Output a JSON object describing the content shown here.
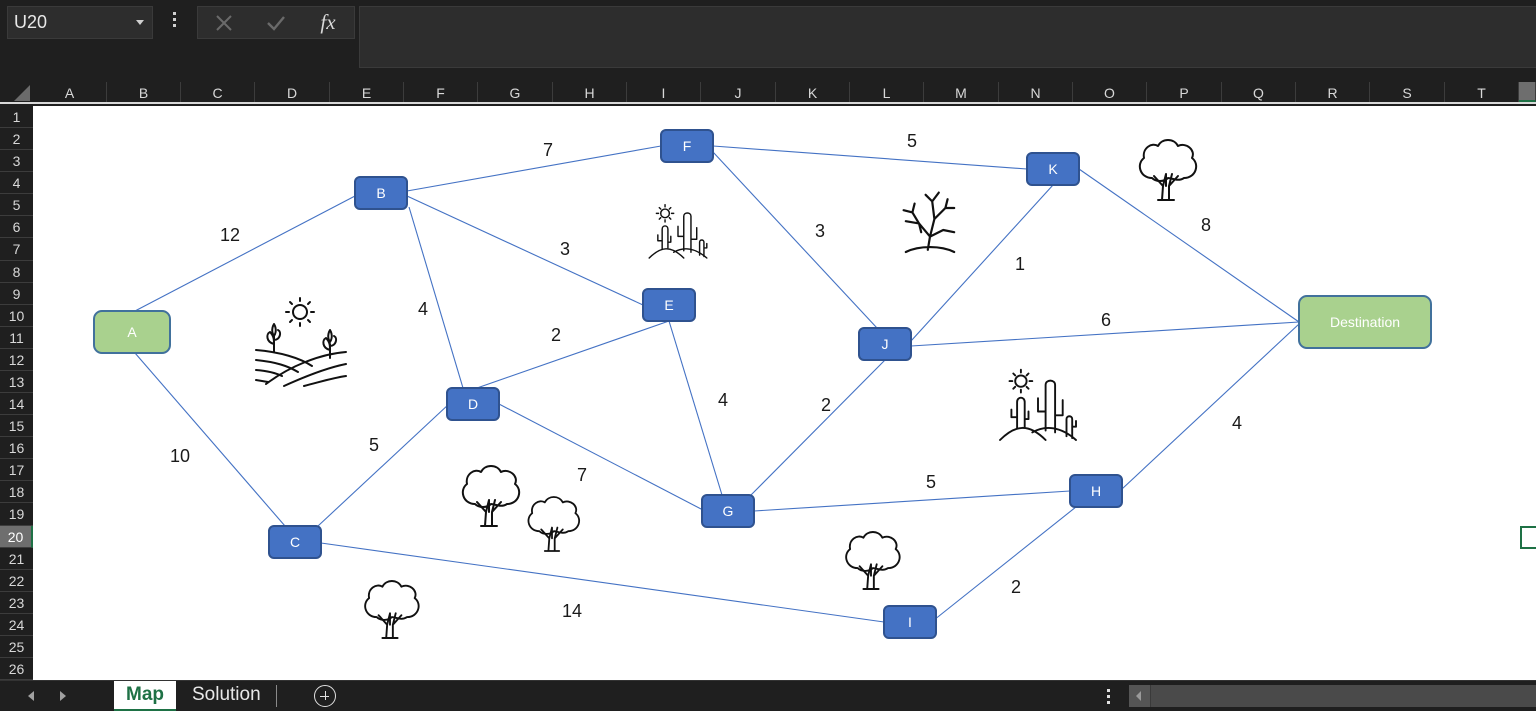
{
  "formula_bar": {
    "name_box": "U20",
    "cancel_icon": "close-icon",
    "enter_icon": "check-icon",
    "function_label": "fx",
    "formula_value": ""
  },
  "columns": [
    "A",
    "B",
    "C",
    "D",
    "E",
    "F",
    "G",
    "H",
    "I",
    "J",
    "K",
    "L",
    "M",
    "N",
    "O",
    "P",
    "Q",
    "R",
    "S",
    "T"
  ],
  "rows": [
    "1",
    "2",
    "3",
    "4",
    "5",
    "6",
    "7",
    "8",
    "9",
    "10",
    "11",
    "12",
    "13",
    "14",
    "15",
    "16",
    "17",
    "18",
    "19",
    "20",
    "21",
    "22",
    "23",
    "24",
    "25",
    "26"
  ],
  "selected_row": "20",
  "sheet_tabs": [
    {
      "label": "Map",
      "active": true
    },
    {
      "label": "Solution",
      "active": false
    }
  ],
  "diagram": {
    "colors": {
      "node_fill": "#4472c4",
      "node_stroke": "#2f528f",
      "terminal_fill": "#a9d18e",
      "terminal_stroke": "#41719c",
      "edge": "#4472c4"
    },
    "nodes": [
      {
        "id": "A",
        "label": "A",
        "type": "terminal"
      },
      {
        "id": "B",
        "label": "B",
        "type": "node"
      },
      {
        "id": "C",
        "label": "C",
        "type": "node"
      },
      {
        "id": "D",
        "label": "D",
        "type": "node"
      },
      {
        "id": "E",
        "label": "E",
        "type": "node"
      },
      {
        "id": "F",
        "label": "F",
        "type": "node"
      },
      {
        "id": "G",
        "label": "G",
        "type": "node"
      },
      {
        "id": "H",
        "label": "H",
        "type": "node"
      },
      {
        "id": "I",
        "label": "I",
        "type": "node"
      },
      {
        "id": "J",
        "label": "J",
        "type": "node"
      },
      {
        "id": "K",
        "label": "K",
        "type": "node"
      },
      {
        "id": "Dest",
        "label": "Destination",
        "type": "terminal"
      }
    ],
    "edges": [
      {
        "from": "A",
        "to": "B",
        "weight": "12"
      },
      {
        "from": "A",
        "to": "C",
        "weight": "10"
      },
      {
        "from": "B",
        "to": "F",
        "weight": "7"
      },
      {
        "from": "B",
        "to": "E",
        "weight": "3"
      },
      {
        "from": "B",
        "to": "D",
        "weight": "4"
      },
      {
        "from": "C",
        "to": "D",
        "weight": "5"
      },
      {
        "from": "C",
        "to": "I",
        "weight": "14"
      },
      {
        "from": "D",
        "to": "E",
        "weight": "2"
      },
      {
        "from": "D",
        "to": "G",
        "weight": "7"
      },
      {
        "from": "E",
        "to": "G",
        "weight": "4"
      },
      {
        "from": "F",
        "to": "K",
        "weight": "5"
      },
      {
        "from": "F",
        "to": "J",
        "weight": "3"
      },
      {
        "from": "G",
        "to": "J",
        "weight": "2"
      },
      {
        "from": "G",
        "to": "H",
        "weight": "5"
      },
      {
        "from": "I",
        "to": "H",
        "weight": "2"
      },
      {
        "from": "J",
        "to": "K",
        "weight": "1"
      },
      {
        "from": "J",
        "to": "Dest",
        "weight": "6"
      },
      {
        "from": "K",
        "to": "Dest",
        "weight": "8"
      },
      {
        "from": "H",
        "to": "Dest",
        "weight": "4"
      }
    ],
    "decorations": [
      {
        "icon": "farmland-icon"
      },
      {
        "icon": "desert-cactus-icon"
      },
      {
        "icon": "bare-tree-icon"
      },
      {
        "icon": "tree-icon"
      },
      {
        "icon": "desert-cactus-icon"
      },
      {
        "icon": "tree-icon"
      },
      {
        "icon": "tree-icon"
      },
      {
        "icon": "tree-icon"
      },
      {
        "icon": "tree-icon"
      }
    ]
  }
}
